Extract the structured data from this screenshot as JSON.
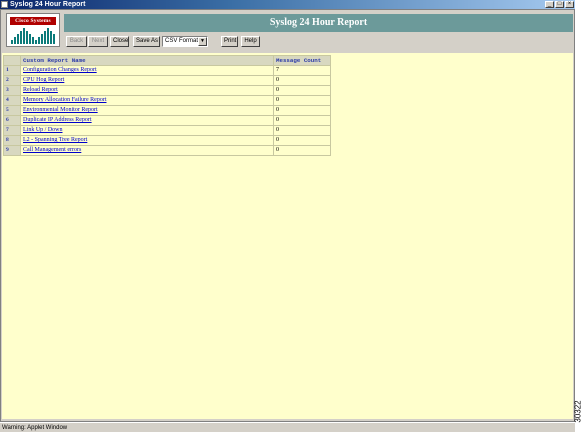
{
  "window": {
    "title": "Syslog 24 Hour Report"
  },
  "logo": {
    "text": "Cisco Systems"
  },
  "header": {
    "title": "Syslog 24 Hour Report"
  },
  "toolbar": {
    "back_label": "Back",
    "next_label": "Next",
    "close_label": "Close",
    "save_as_label": "Save As",
    "format_value": "CSV Format",
    "print_label": "Print",
    "help_label": "Help"
  },
  "table": {
    "headers": [
      "",
      "Custom Report Name",
      "Message Count"
    ],
    "rows": [
      {
        "n": "1",
        "name": "Configuration Changes Report",
        "count": "7"
      },
      {
        "n": "2",
        "name": "CPU Hog Report",
        "count": "0"
      },
      {
        "n": "3",
        "name": "Reload Report",
        "count": "0"
      },
      {
        "n": "4",
        "name": "Memory Allocation Failure Report",
        "count": "0"
      },
      {
        "n": "5",
        "name": "Environmental Monitor Report",
        "count": "0"
      },
      {
        "n": "6",
        "name": "Duplicate IP Address Report",
        "count": "0"
      },
      {
        "n": "7",
        "name": "Link Up / Down",
        "count": "0"
      },
      {
        "n": "8",
        "name": "L2 - Spanning Tree Report",
        "count": "0"
      },
      {
        "n": "9",
        "name": "Call Management errors",
        "count": "0"
      }
    ]
  },
  "status": {
    "text": "Warning: Applet Window"
  },
  "figure_id": "30322"
}
